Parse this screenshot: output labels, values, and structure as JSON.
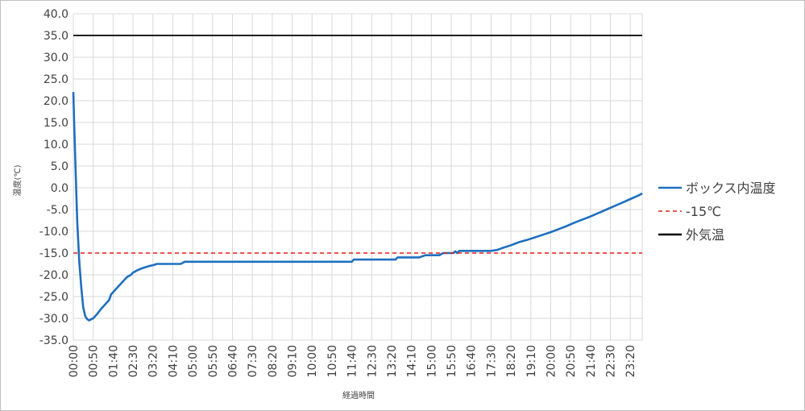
{
  "chart_data": {
    "type": "line",
    "title": "",
    "xlabel": "経過時間",
    "ylabel": "温度(℃)",
    "ylim": [
      -35,
      40
    ],
    "ytick_step": 5,
    "y_ticks": [
      "40.0",
      "35.0",
      "30.0",
      "25.0",
      "20.0",
      "15.0",
      "10.0",
      "5.0",
      "0.0",
      "-5.0",
      "-10.0",
      "-15.0",
      "-20.0",
      "-25.0",
      "-30.0",
      "-35.0"
    ],
    "x_ticks": [
      "00:00",
      "00:50",
      "01:40",
      "02:30",
      "03:20",
      "04:10",
      "05:00",
      "05:50",
      "06:40",
      "07:30",
      "08:20",
      "09:10",
      "10:00",
      "10:50",
      "11:40",
      "12:30",
      "13:20",
      "14:10",
      "15:00",
      "15:50",
      "16:40",
      "17:30",
      "18:20",
      "19:10",
      "20:00",
      "20:50",
      "21:40",
      "22:30",
      "23:20"
    ],
    "xlim_minutes": [
      0,
      1430
    ],
    "grid": true,
    "legend_position": "right",
    "series": [
      {
        "name": "ボックス内温度",
        "color": "#1f6fbf",
        "style": "solid",
        "x": [
          "00:00",
          "00:02",
          "00:04",
          "00:06",
          "00:10",
          "00:15",
          "00:20",
          "00:25",
          "00:30",
          "00:35",
          "00:40",
          "00:45",
          "00:50",
          "01:00",
          "01:10",
          "01:20",
          "01:30",
          "01:35",
          "01:45",
          "02:00",
          "02:15",
          "02:25",
          "02:30",
          "02:40",
          "02:50",
          "03:00",
          "03:10",
          "03:20",
          "03:30",
          "04:00",
          "04:30",
          "04:40",
          "05:00",
          "06:00",
          "07:00",
          "08:00",
          "09:00",
          "10:00",
          "11:00",
          "11:40",
          "11:45",
          "12:30",
          "13:00",
          "13:30",
          "13:35",
          "14:00",
          "14:30",
          "14:45",
          "15:00",
          "15:20",
          "15:30",
          "15:45",
          "15:55",
          "16:00",
          "16:05",
          "16:10",
          "16:20",
          "16:40",
          "17:00",
          "17:30",
          "17:45",
          "18:00",
          "18:20",
          "18:40",
          "19:00",
          "19:20",
          "19:40",
          "20:00",
          "20:20",
          "20:40",
          "21:00",
          "21:20",
          "21:40",
          "22:00",
          "22:20",
          "22:40",
          "23:00",
          "23:20",
          "23:40",
          "23:50"
        ],
        "values": [
          22.0,
          15.0,
          9.0,
          3.0,
          -8.0,
          -17.0,
          -23.0,
          -27.5,
          -29.5,
          -30.2,
          -30.5,
          -30.2,
          -30.0,
          -29.0,
          -27.8,
          -26.8,
          -25.8,
          -24.5,
          -23.5,
          -22.0,
          -20.5,
          -20.0,
          -19.5,
          -19.0,
          -18.6,
          -18.3,
          -18.0,
          -17.8,
          -17.5,
          -17.5,
          -17.5,
          -17.0,
          -17.0,
          -17.0,
          -17.0,
          -17.0,
          -17.0,
          -17.0,
          -17.0,
          -17.0,
          -16.5,
          -16.5,
          -16.5,
          -16.5,
          -16.0,
          -16.0,
          -16.0,
          -15.5,
          -15.5,
          -15.5,
          -15.0,
          -15.0,
          -15.0,
          -14.6,
          -15.0,
          -14.5,
          -14.5,
          -14.5,
          -14.5,
          -14.5,
          -14.3,
          -13.8,
          -13.2,
          -12.5,
          -12.0,
          -11.4,
          -10.8,
          -10.2,
          -9.5,
          -8.8,
          -8.0,
          -7.3,
          -6.6,
          -5.8,
          -5.0,
          -4.2,
          -3.4,
          -2.6,
          -1.8,
          -1.3
        ]
      },
      {
        "name": "-15℃",
        "color": "#e0201b",
        "style": "dashed",
        "x": [
          "00:00",
          "23:50"
        ],
        "values": [
          -15,
          -15
        ]
      },
      {
        "name": "外気温",
        "color": "#000000",
        "style": "solid",
        "x": [
          "00:00",
          "23:50"
        ],
        "values": [
          35,
          35
        ]
      }
    ]
  }
}
